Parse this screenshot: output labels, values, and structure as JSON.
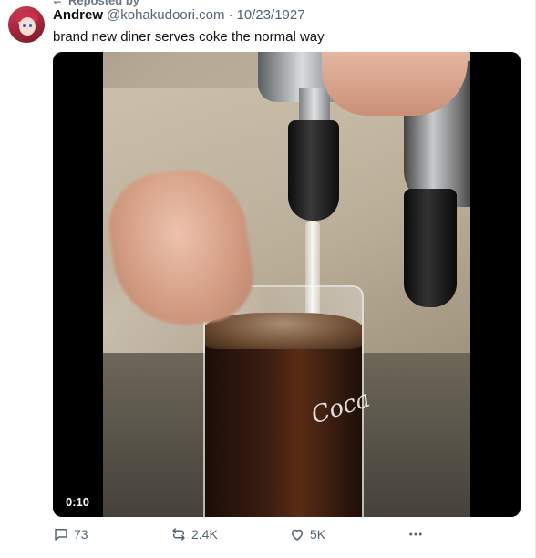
{
  "repost": {
    "label": "Reposted by"
  },
  "post": {
    "author_name": "Andrew",
    "author_handle": "@kohakudoori.com",
    "separator": "·",
    "date": "10/23/1927",
    "text": "brand new diner serves coke the normal way"
  },
  "media": {
    "duration": "0:10",
    "overlay_text": "Coca"
  },
  "actions": {
    "replies": "73",
    "reposts": "2.4K",
    "likes": "5K",
    "more_icon": "ellipsis-icon"
  },
  "colors": {
    "text": "#0f1419",
    "secondary": "#536471",
    "background": "#ffffff"
  }
}
